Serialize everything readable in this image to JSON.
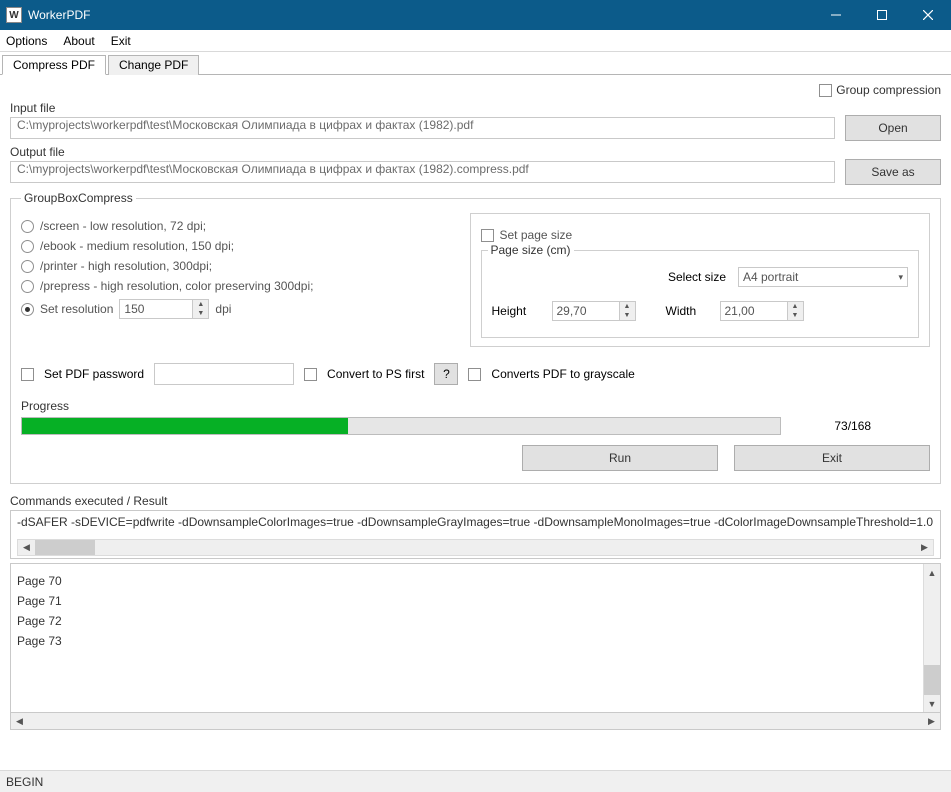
{
  "window": {
    "title": "WorkerPDF"
  },
  "menu": {
    "options": "Options",
    "about": "About",
    "exit": "Exit"
  },
  "tabs": {
    "compress": "Compress PDF",
    "change": "Change PDF"
  },
  "group_compression": {
    "label": "Group compression",
    "checked": false
  },
  "files": {
    "input_label": "Input file",
    "input_value": "C:\\myprojects\\workerpdf\\test\\Московская Олимпиада в цифрах и фактах (1982).pdf",
    "open_button": "Open",
    "output_label": "Output file",
    "output_value": "C:\\myprojects\\workerpdf\\test\\Московская Олимпиада в цифрах и фактах (1982).compress.pdf",
    "save_as_button": "Save as"
  },
  "compress_group": {
    "legend": "GroupBoxCompress",
    "radios": {
      "screen": "/screen - low resolution, 72 dpi;",
      "ebook": "/ebook - medium resolution, 150 dpi;",
      "printer": "/printer - high resolution, 300dpi;",
      "prepress": "/prepress - high resolution, color preserving 300dpi;",
      "set_resolution": "Set resolution",
      "dpi_value": "150",
      "dpi_suffix": "dpi"
    }
  },
  "page_size": {
    "set_page_size": "Set page size",
    "set_page_size_checked": false,
    "legend": "Page size (cm)",
    "select_size_label": "Select size",
    "select_size_value": "A4 portrait",
    "height_label": "Height",
    "height_value": "29,70",
    "width_label": "Width",
    "width_value": "21,00"
  },
  "options_row": {
    "set_pdf_password": "Set PDF password",
    "set_pdf_password_checked": false,
    "password_value": "",
    "convert_ps": "Convert to PS first",
    "convert_ps_checked": false,
    "help_icon": "?",
    "grayscale": "Converts PDF to grayscale",
    "grayscale_checked": false
  },
  "progress": {
    "label": "Progress",
    "percent": 43,
    "text": "73/168"
  },
  "buttons": {
    "run": "Run",
    "exit": "Exit"
  },
  "result": {
    "label": "Commands executed / Result",
    "cmd": "-dSAFER -sDEVICE=pdfwrite -dDownsampleColorImages=true -dDownsampleGrayImages=true -dDownsampleMonoImages=true -dColorImageDownsampleThreshold=1.0"
  },
  "log": {
    "lines": [
      "Page 70",
      "Page 71",
      "Page 72",
      "Page 73"
    ]
  },
  "status": {
    "text": "BEGIN"
  }
}
